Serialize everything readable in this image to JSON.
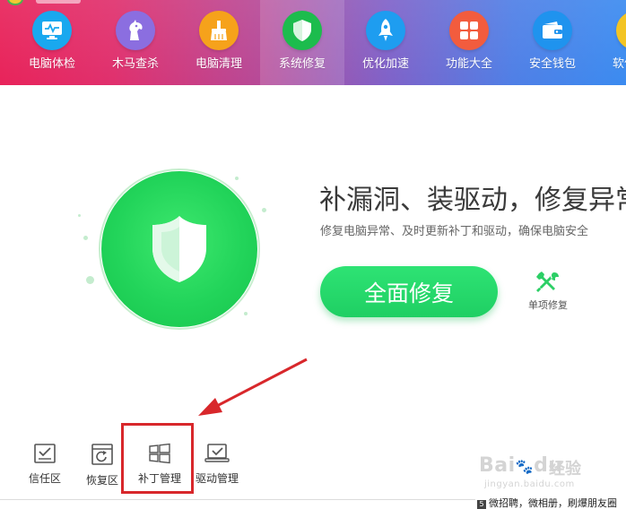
{
  "nav": {
    "items": [
      {
        "label": "电脑体检",
        "icon": "monitor-check-icon",
        "color": "#19a8ef"
      },
      {
        "label": "木马查杀",
        "icon": "horse-icon",
        "color": "#8b6ee0"
      },
      {
        "label": "电脑清理",
        "icon": "broom-icon",
        "color": "#f6a21b"
      },
      {
        "label": "系统修复",
        "icon": "shield-icon",
        "color": "#1cbc4d"
      },
      {
        "label": "优化加速",
        "icon": "rocket-icon",
        "color": "#1e9df0"
      },
      {
        "label": "功能大全",
        "icon": "grid-icon",
        "color": "#f25c3e"
      },
      {
        "label": "安全钱包",
        "icon": "wallet-icon",
        "color": "#1f93ee"
      },
      {
        "label": "软件管家",
        "icon": "software-icon",
        "color": "#f3c423"
      }
    ],
    "active_index": 3
  },
  "hero": {
    "title": "补漏洞、装驱动，修复异常",
    "subtitle": "修复电脑异常、及时更新补丁和驱动，确保电脑安全",
    "repair_button": "全面修复",
    "single_repair_label": "单项修复",
    "accent": "#22d45a"
  },
  "tools": [
    {
      "label": "信任区",
      "icon": "trust-zone-icon"
    },
    {
      "label": "恢复区",
      "icon": "restore-zone-icon"
    },
    {
      "label": "补丁管理",
      "icon": "windows-icon"
    },
    {
      "label": "驱动管理",
      "icon": "driver-manage-icon"
    }
  ],
  "annotation": {
    "color": "#d8272b",
    "highlighted_tool": "补丁管理"
  },
  "watermark": {
    "brand": "Bai",
    "brand_paw": "du",
    "product": "经验",
    "url": "jingyan.baidu.com"
  },
  "footer_strip": {
    "number": "5",
    "text": "微招聘，微相册，刷爆朋友圈"
  }
}
